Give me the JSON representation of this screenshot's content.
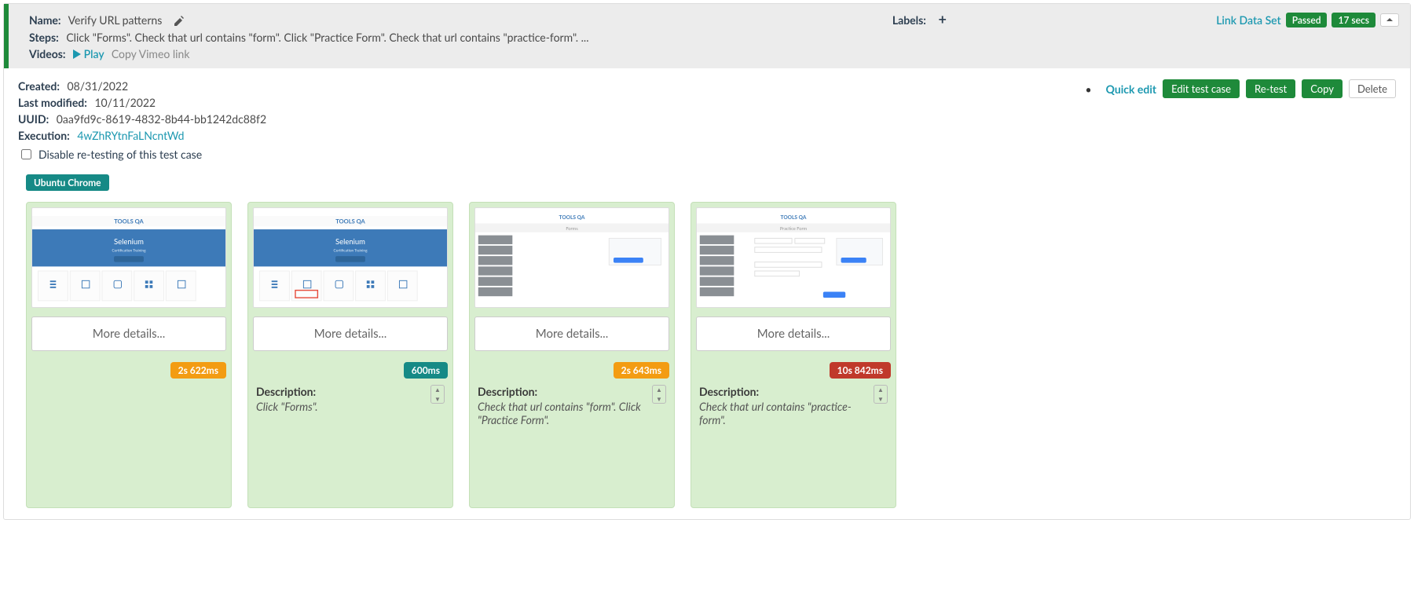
{
  "header": {
    "nameLabel": "Name:",
    "nameValue": "Verify URL patterns",
    "labelsLabel": "Labels:",
    "linkDataSet": "Link Data Set",
    "statusTag": "Passed",
    "durationTag": "17 secs",
    "stepsLabel": "Steps:",
    "stepsValue": "Click \"Forms\". Check that url contains \"form\". Click \"Practice Form\". Check that url contains \"practice-form\".   ...",
    "videosLabel": "Videos:",
    "playLabel": " Play",
    "copyVimeo": "Copy Vimeo link"
  },
  "meta": {
    "createdLabel": "Created:",
    "createdValue": "08/31/2022",
    "modifiedLabel": "Last modified:",
    "modifiedValue": "10/11/2022",
    "uuidLabel": "UUID:",
    "uuidValue": "0aa9fd9c-8619-4832-8b44-bb1242dc88f2",
    "executionLabel": "Execution:",
    "executionValue": "4wZhRYtnFaLNcntWd",
    "disableRetestingLabel": "Disable re-testing of this test case"
  },
  "actions": {
    "quickEdit": "Quick edit",
    "editTestCase": "Edit test case",
    "retest": "Re-test",
    "copy": "Copy",
    "delete": "Delete"
  },
  "environmentTag": "Ubuntu Chrome",
  "cards": [
    {
      "moreDetails": "More details...",
      "chipText": "2s 622ms",
      "chipClass": "orange",
      "hasDescription": false
    },
    {
      "moreDetails": "More details...",
      "chipText": "600ms",
      "chipClass": "teal",
      "hasDescription": true,
      "descLabel": "Description:",
      "descText": "Click \"Forms\".",
      "hasStepper": true
    },
    {
      "moreDetails": "More details...",
      "chipText": "2s 643ms",
      "chipClass": "orange",
      "hasDescription": true,
      "descLabel": "Description:",
      "descText": "Check that url contains \"form\". Click \"Practice Form\".",
      "hasStepper": true
    },
    {
      "moreDetails": "More details...",
      "chipText": "10s 842ms",
      "chipClass": "red",
      "hasDescription": true,
      "descLabel": "Description:",
      "descText": "Check that url contains \"practice-form\".",
      "hasStepper": true
    }
  ]
}
